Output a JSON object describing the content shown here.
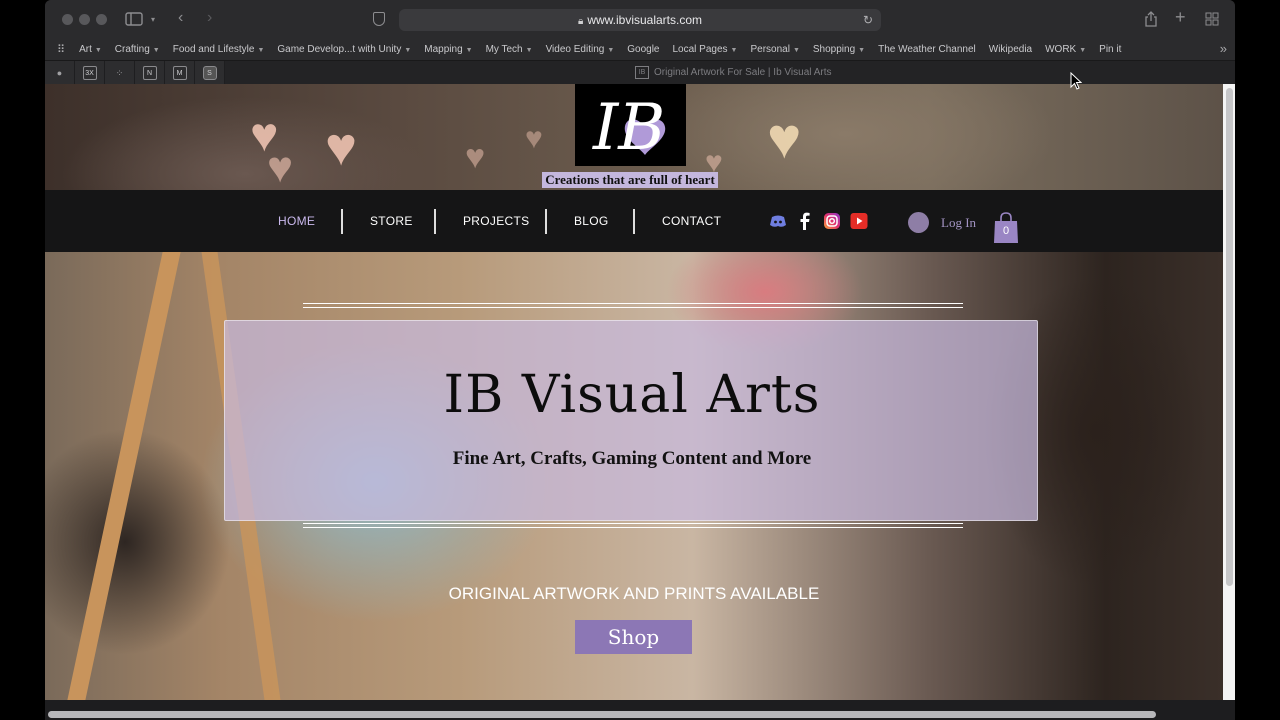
{
  "browser": {
    "url": "www.ibvisualarts.com",
    "tab_title": "Original Artwork For Sale | Ib Visual Arts",
    "bookmarks": [
      {
        "label": "Art",
        "menu": true
      },
      {
        "label": "Crafting",
        "menu": true
      },
      {
        "label": "Food and Lifestyle",
        "menu": true
      },
      {
        "label": "Game Develop...t with Unity",
        "menu": true
      },
      {
        "label": "Mapping",
        "menu": true
      },
      {
        "label": "My Tech",
        "menu": true
      },
      {
        "label": "Video Editing",
        "menu": true
      },
      {
        "label": "Google",
        "menu": false
      },
      {
        "label": "Local Pages",
        "menu": true
      },
      {
        "label": "Personal",
        "menu": true
      },
      {
        "label": "Shopping",
        "menu": true
      },
      {
        "label": "The Weather Channel",
        "menu": false
      },
      {
        "label": "Wikipedia",
        "menu": false
      },
      {
        "label": "WORK",
        "menu": true
      },
      {
        "label": "Pin it",
        "menu": false
      }
    ],
    "pinned_tabs": [
      "apple-icon",
      "3x-icon",
      "dots-icon",
      "n-icon",
      "m-icon",
      "s-icon"
    ],
    "pinned_glyphs": [
      "",
      "3X",
      "⁘",
      "N",
      "M",
      "S"
    ]
  },
  "site": {
    "logo_text": "IB",
    "tagline": "Creations that are full of heart",
    "nav": {
      "home": "HOME",
      "store": "STORE",
      "projects": "PROJECTS",
      "blog": "BLOG",
      "contact": "CONTACT"
    },
    "social": [
      "discord-icon",
      "facebook-icon",
      "instagram-icon",
      "youtube-icon"
    ],
    "login": "Log In",
    "cart_count": "0",
    "hero": {
      "title": "IB Visual Arts",
      "subtitle": "Fine Art, Crafts, Gaming Content and More",
      "caption": "ORIGINAL ARTWORK AND PRINTS AVAILABLE",
      "button": "Shop"
    }
  },
  "colors": {
    "accent": "#8c77b5",
    "nav_active": "#c9b8ec",
    "tagline_bg": "#c4b7dd"
  }
}
